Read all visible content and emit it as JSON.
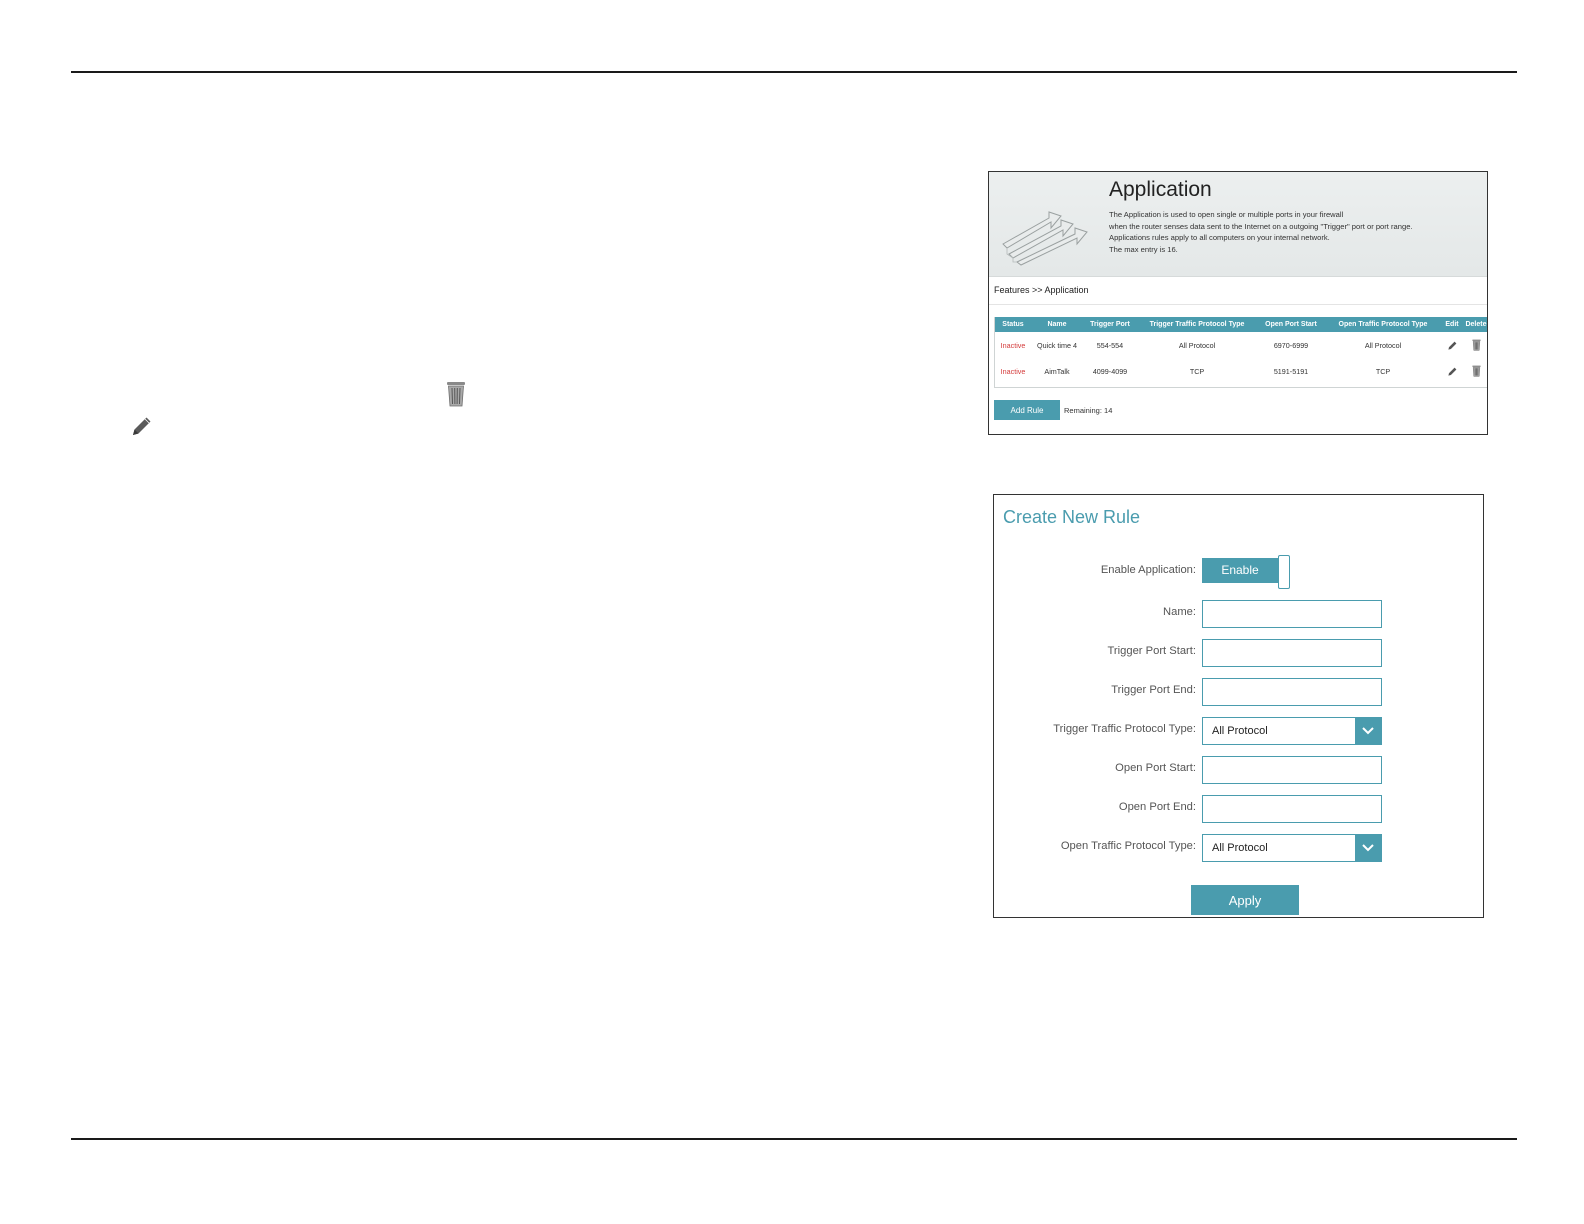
{
  "legend": {
    "delete_icon": "trash-icon",
    "edit_icon": "pencil-icon"
  },
  "application": {
    "title": "Application",
    "description": [
      "The Application is used to open single or multiple ports in your firewall",
      "when the router senses data sent to the Internet on a outgoing \"Trigger\" port or port range.",
      "Applications rules apply to all computers on your internal network.",
      "The max entry is 16."
    ],
    "breadcrumb": "Features >> Application",
    "table": {
      "columns": [
        "Status",
        "Name",
        "Trigger Port",
        "Trigger Traffic Protocol Type",
        "Open Port Start",
        "Open Traffic Protocol Type",
        "Edit",
        "Delete"
      ],
      "rows": [
        {
          "status": "Inactive",
          "name": "Quick time 4",
          "trigger_port": "554-554",
          "trigger_protocol": "All Protocol",
          "open_port": "6970-6999",
          "open_protocol": "All Protocol"
        },
        {
          "status": "Inactive",
          "name": "AimTalk",
          "trigger_port": "4099-4099",
          "trigger_protocol": "TCP",
          "open_port": "5191-5191",
          "open_protocol": "TCP"
        }
      ]
    },
    "add_rule_label": "Add Rule",
    "remaining": "Remaining: 14"
  },
  "create_rule": {
    "title": "Create New Rule",
    "enable_label": "Enable Application:",
    "enable_value": "Enable",
    "name_label": "Name:",
    "name_value": "",
    "trigger_start_label": "Trigger Port Start:",
    "trigger_start_value": "",
    "trigger_end_label": "Trigger Port End:",
    "trigger_end_value": "",
    "trigger_protocol_label": "Trigger Traffic Protocol Type:",
    "trigger_protocol_value": "All Protocol",
    "open_start_label": "Open Port Start:",
    "open_start_value": "",
    "open_end_label": "Open Port End:",
    "open_end_value": "",
    "open_protocol_label": "Open Traffic Protocol Type:",
    "open_protocol_value": "All Protocol",
    "apply_label": "Apply"
  },
  "colors": {
    "accent": "#4a9cae",
    "inactive": "#d43b3b"
  }
}
